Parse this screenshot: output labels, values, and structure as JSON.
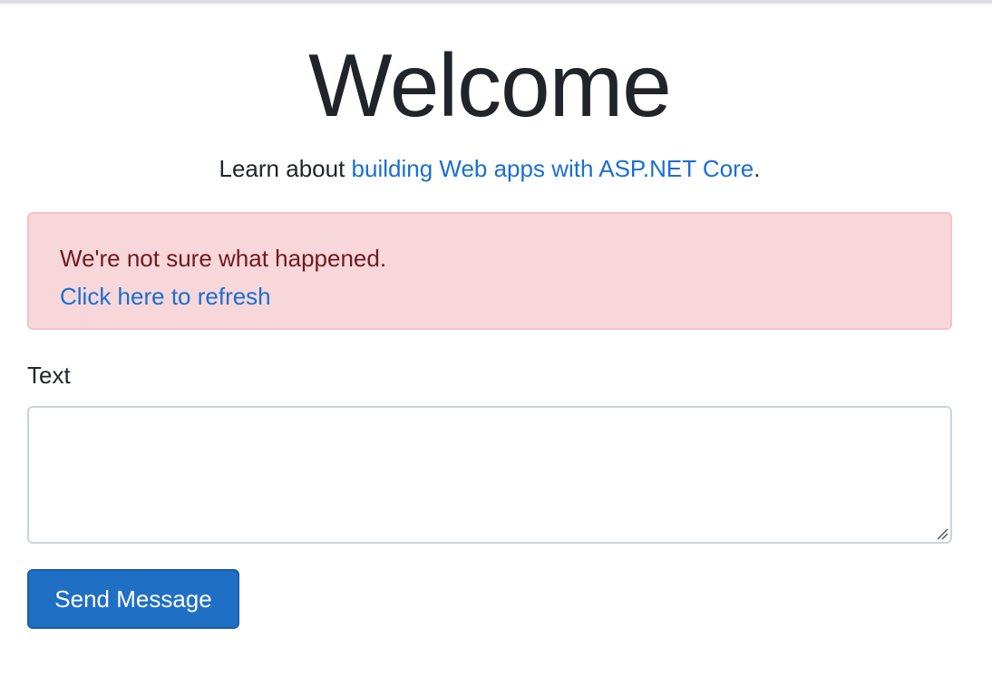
{
  "header": {
    "title": "Welcome"
  },
  "lead": {
    "prefix": "Learn about ",
    "link_text": "building Web apps with ASP.NET Core",
    "suffix": "."
  },
  "alert": {
    "message": "We're not sure what happened.",
    "refresh_link": "Click here to refresh"
  },
  "form": {
    "text_label": "Text",
    "text_value": "",
    "send_label": "Send Message"
  },
  "colors": {
    "link": "#1a6fd1",
    "alert_bg": "#f8d7da",
    "alert_text": "#842029",
    "primary_button": "#1f6fc5"
  },
  "icons": {
    "resize_handle": "resize-grip-icon"
  }
}
